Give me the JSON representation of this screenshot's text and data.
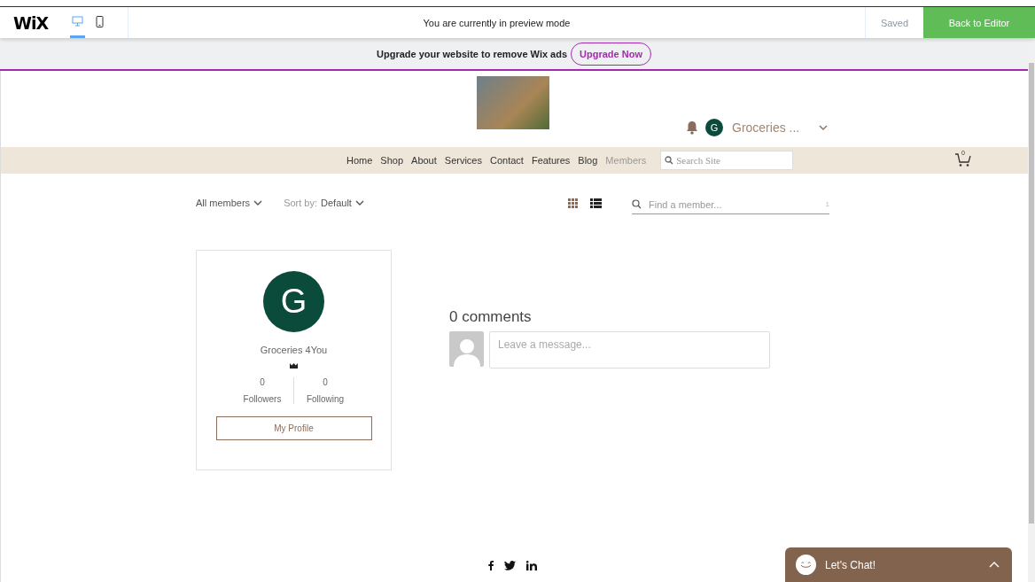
{
  "preview_bar": {
    "logo": "WiX",
    "devices": [
      {
        "kind": "desktop",
        "selected": true
      },
      {
        "kind": "mobile",
        "selected": false
      }
    ],
    "message": "You are currently in preview mode",
    "status": "Saved",
    "back_button": "Back to Editor"
  },
  "ad_bar": {
    "text": "Upgrade your website to remove Wix ads",
    "button": "Upgrade Now"
  },
  "header": {
    "user": {
      "initial": "G",
      "name": "Groceries ..."
    }
  },
  "nav": {
    "items": [
      {
        "label": "Home",
        "selected": false
      },
      {
        "label": "Shop",
        "selected": false
      },
      {
        "label": "About",
        "selected": false
      },
      {
        "label": "Services",
        "selected": false
      },
      {
        "label": "Contact",
        "selected": false
      },
      {
        "label": "Features",
        "selected": false
      },
      {
        "label": "Blog",
        "selected": false
      },
      {
        "label": "Members",
        "selected": true
      }
    ],
    "search_placeholder": "Search Site",
    "cart_count": "0"
  },
  "toolbar": {
    "filter": "All members",
    "sort_label": "Sort by:",
    "sort_value": "Default",
    "views": [
      {
        "kind": "grid",
        "selected": false
      },
      {
        "kind": "list",
        "selected": true
      }
    ],
    "search_placeholder": "Find a member...",
    "search_counter": "1"
  },
  "member_card": {
    "initial": "G",
    "name": "Groceries 4You",
    "stats": [
      {
        "value": "0",
        "label": "Followers"
      },
      {
        "value": "0",
        "label": "Following"
      }
    ],
    "button": "My Profile"
  },
  "comments": {
    "title": "0 comments",
    "placeholder": "Leave a message..."
  },
  "chat": {
    "label": "Let's Chat!"
  }
}
